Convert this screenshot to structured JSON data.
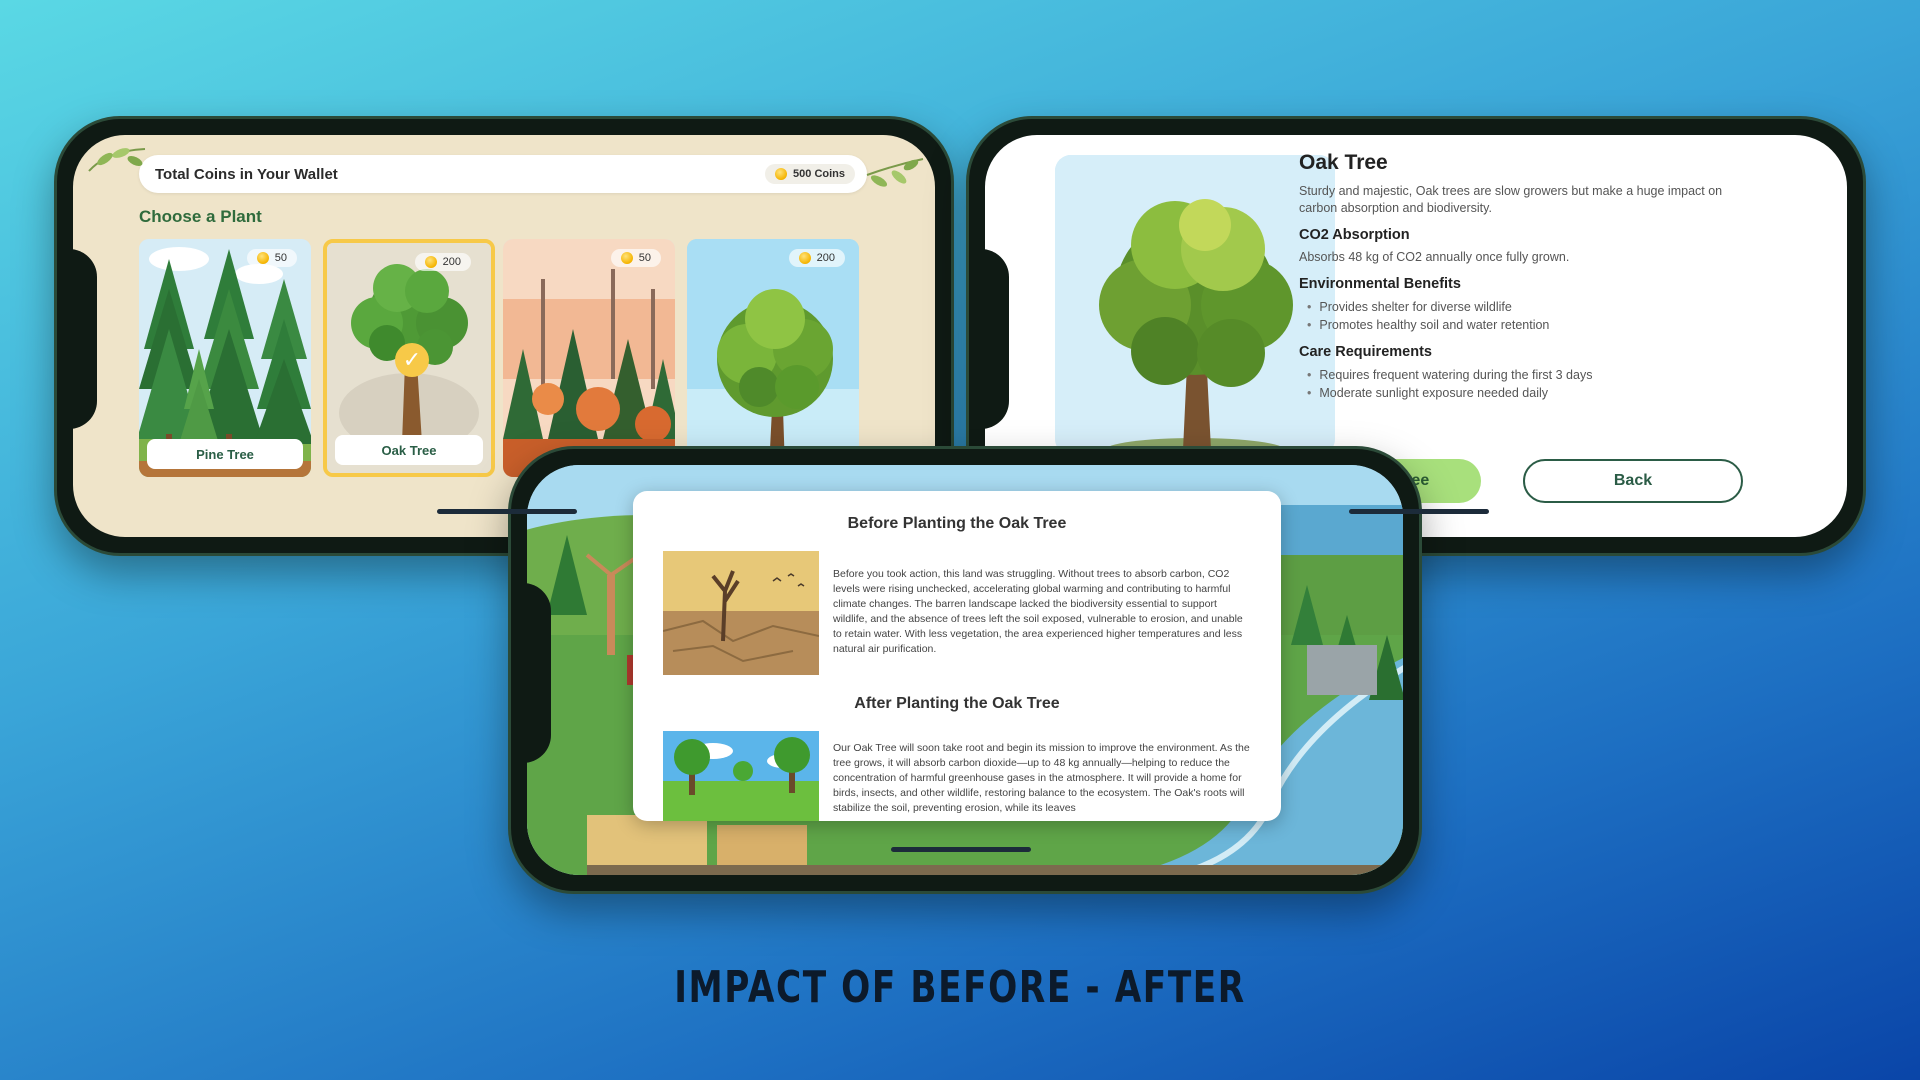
{
  "colors": {
    "accent_green": "#2f6b3c",
    "plant_button": "#a8e07c",
    "selected_border": "#f7c948",
    "cream_bg": "#efe4c9"
  },
  "select_screen": {
    "wallet_title": "Total Coins in Your Wallet",
    "wallet_coins": "500 Coins",
    "section_title": "Choose a Plant",
    "plants": [
      {
        "name": "Pine Tree",
        "price": "50",
        "selected": false
      },
      {
        "name": "Oak Tree",
        "price": "200",
        "selected": true
      },
      {
        "name": "",
        "price": "50",
        "selected": false
      },
      {
        "name": "",
        "price": "200",
        "selected": false
      }
    ]
  },
  "detail_screen": {
    "title": "Oak Tree",
    "description": "Sturdy and majestic, Oak trees are slow growers but make a huge impact on carbon absorption and biodiversity.",
    "co2_heading": "CO2 Absorption",
    "co2_text": "Absorbs 48 kg of CO2 annually once fully grown.",
    "env_heading": "Environmental Benefits",
    "env_items": [
      "Provides shelter for diverse wildlife",
      "Promotes healthy soil and water retention"
    ],
    "care_heading": "Care Requirements",
    "care_items": [
      "Requires frequent watering during the first 3 days",
      "Moderate sunlight exposure needed daily"
    ],
    "plant_button": "Plant Tree",
    "back_button": "Back"
  },
  "impact_screen": {
    "before_title": "Before Planting the Oak Tree",
    "before_text": "Before you took action, this land was struggling.  Without trees to absorb carbon, CO2 levels were rising unchecked, accelerating global warming and contributing to harmful climate changes. The barren landscape lacked the biodiversity essential to support wildlife, and the absence of trees left the soil exposed, vulnerable to erosion, and unable to retain water. With less vegetation, the area experienced higher temperatures and less natural air purification.",
    "after_title": "After Planting the Oak Tree",
    "after_text": "Our Oak Tree will soon take root and begin its mission to improve the environment. As the tree grows, it will absorb carbon dioxide—up to 48 kg annually—helping to reduce the concentration of harmful greenhouse gases in the atmosphere. It will provide a home for birds, insects, and other wildlife, restoring balance to the ecosystem. The Oak's roots will stabilize the soil, preventing erosion, while its leaves"
  },
  "caption": "IMPACT OF BEFORE - AFTER"
}
